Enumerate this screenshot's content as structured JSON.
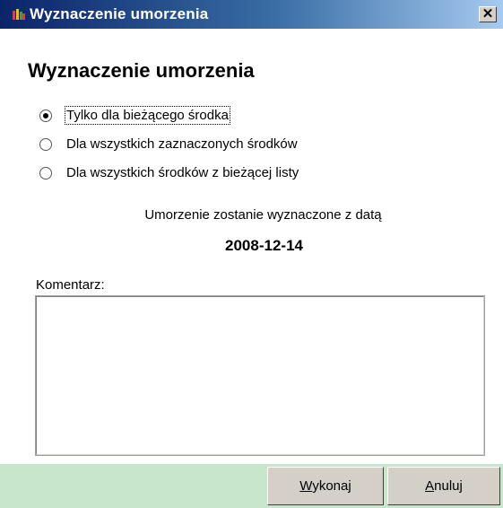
{
  "window": {
    "title": "Wyznaczenie umorzenia",
    "close_glyph": "✕"
  },
  "dialog": {
    "heading": "Wyznaczenie umorzenia"
  },
  "scope_options": [
    {
      "label": "Tylko dla bieżącego środka",
      "selected": true
    },
    {
      "label": "Dla wszystkich zaznaczonych środków",
      "selected": false
    },
    {
      "label": "Dla wszystkich środków z bieżącej listy",
      "selected": false
    }
  ],
  "info": {
    "text": "Umorzenie zostanie wyznaczone z datą",
    "date": "2008-12-14"
  },
  "comment": {
    "label": "Komentarz:",
    "value": ""
  },
  "buttons": {
    "execute_accel": "W",
    "execute_rest": "ykonaj",
    "cancel_accel": "A",
    "cancel_rest": "nuluj"
  },
  "colors": {
    "titlebar_start": "#0a246a",
    "footer_bg": "#c8e6cc",
    "button_face": "#d4d0c8"
  },
  "icons": {
    "app": "app-icon",
    "close": "close-icon"
  }
}
